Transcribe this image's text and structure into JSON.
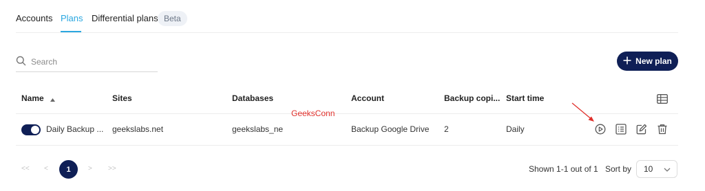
{
  "tabs": [
    {
      "label": "Accounts"
    },
    {
      "label": "Plans"
    },
    {
      "label": "Differential plans"
    }
  ],
  "beta_badge": "Beta",
  "search": {
    "placeholder": "Search",
    "value": ""
  },
  "new_plan_label": "New plan",
  "table": {
    "columns": [
      "Name",
      "Sites",
      "Databases",
      "Account",
      "Backup copi...",
      "Start time"
    ],
    "sort": {
      "column": "Name",
      "direction": "ascending"
    },
    "rows": [
      {
        "enabled": true,
        "name": "Daily Backup ...",
        "sites": "geekslabs.net",
        "databases": "geekslabs_ne",
        "account": "Backup Google Drive",
        "backup_copies": "2",
        "start_time": "Daily"
      }
    ]
  },
  "watermark": "GeeksConn",
  "pagination": {
    "first": "<<",
    "prev": "<",
    "current": "1",
    "next": ">",
    "last": ">>",
    "shown_text": "Shown 1-1 out of 1",
    "sort_by_label": "Sort by",
    "page_size": "10"
  },
  "colors": {
    "accent": "#2aa7e0",
    "primary": "#0f1f56",
    "annotation_red": "#e0302b"
  },
  "icons": [
    "search-icon",
    "plus-icon",
    "sort-asc-icon",
    "columns-grid-icon",
    "play-icon",
    "details-list-icon",
    "edit-icon",
    "trash-icon",
    "chevron-down-icon",
    "annotation-arrow"
  ]
}
